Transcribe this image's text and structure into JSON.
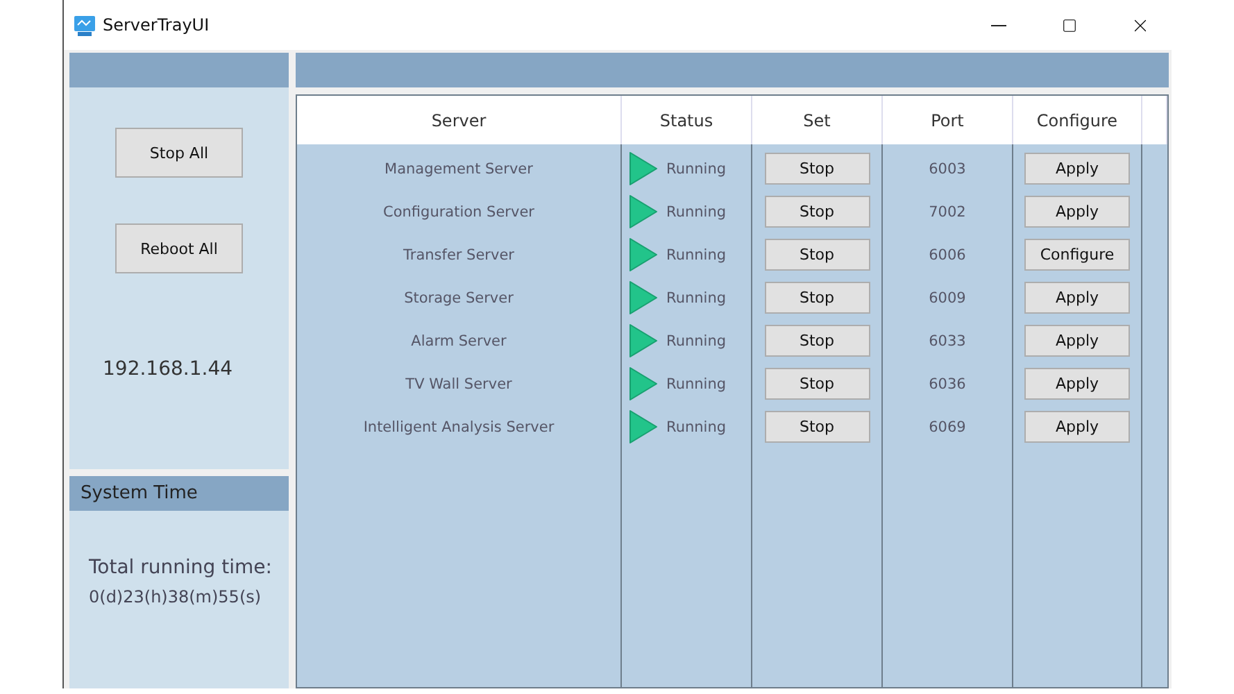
{
  "window": {
    "title": "ServerTrayUI"
  },
  "sidebar": {
    "buttons": [
      "Stop All",
      "Reboot All"
    ],
    "ip": "192.168.1.44"
  },
  "system_time": {
    "title": "System Time",
    "label": "Total running time:",
    "value": "0(d)23(h)38(m)55(s)"
  },
  "table": {
    "columns": [
      "Server",
      "Status",
      "Set",
      "Port",
      "Configure"
    ],
    "rows": [
      {
        "server": "Management Server",
        "status": "Running",
        "running": true,
        "set": "Stop",
        "port": "6003",
        "configure": "Apply"
      },
      {
        "server": "Configuration Server",
        "status": "Running",
        "running": true,
        "set": "Stop",
        "port": "7002",
        "configure": "Apply"
      },
      {
        "server": "Transfer Server",
        "status": "Running",
        "running": true,
        "set": "Stop",
        "port": "6006",
        "configure": "Configure"
      },
      {
        "server": "Storage Server",
        "status": "Running",
        "running": true,
        "set": "Stop",
        "port": "6009",
        "configure": "Apply"
      },
      {
        "server": "Alarm Server",
        "status": "Running",
        "running": true,
        "set": "Stop",
        "port": "6033",
        "configure": "Apply"
      },
      {
        "server": "TV Wall Server",
        "status": "Running",
        "running": true,
        "set": "Stop",
        "port": "6036",
        "configure": "Apply"
      },
      {
        "server": "Intelligent Analysis Server",
        "status": "Running",
        "running": true,
        "set": "Stop",
        "port": "6069",
        "configure": "Apply"
      }
    ]
  }
}
